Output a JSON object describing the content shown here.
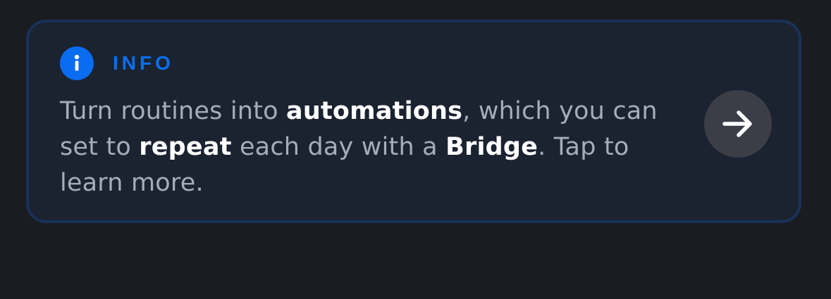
{
  "info_card": {
    "icon": "info-icon",
    "label": "INFO",
    "message": {
      "part1": "Turn routines into ",
      "bold1": "automations",
      "part2": ", which you can set to ",
      "bold2": "repeat",
      "part3": " each day with a ",
      "bold3": "Bridge",
      "part4": ". Tap to learn more."
    },
    "action_icon": "arrow-right-icon",
    "colors": {
      "accent": "#0a6cf0",
      "card_background": "#1b2230",
      "card_border": "#17325a",
      "page_background": "#1a1c21",
      "button_background": "#3b3e47",
      "body_text": "#a7adb8",
      "emphasis_text": "#ffffff"
    }
  }
}
